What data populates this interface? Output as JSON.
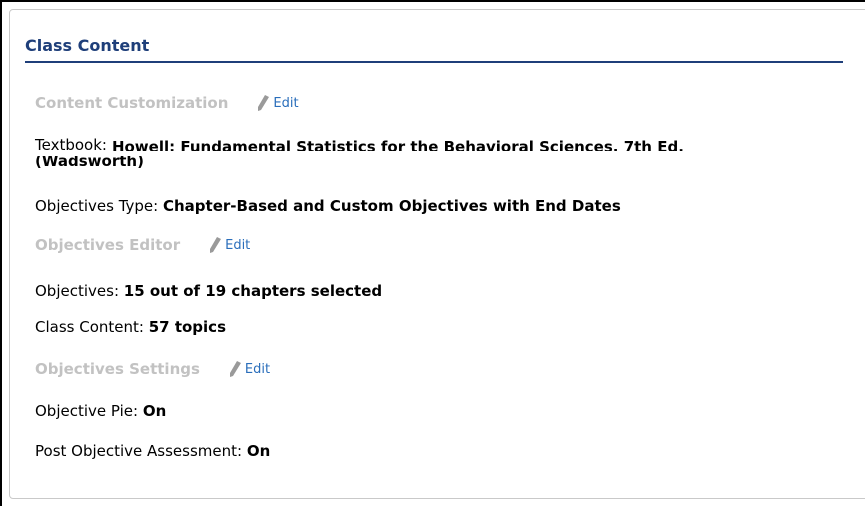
{
  "panel": {
    "title": "Class Content",
    "content_customization": {
      "label": "Content Customization",
      "edit": "Edit"
    },
    "textbook": {
      "label": "Textbook:",
      "value_line1": "Howell: Fundamental Statistics for the Behavioral Sciences, 7th Ed.",
      "value_line2": "(Wadsworth)"
    },
    "objectives_type": {
      "label": "Objectives Type:",
      "value": "Chapter-Based and Custom Objectives with End Dates"
    },
    "objectives_editor": {
      "label": "Objectives Editor",
      "edit": "Edit"
    },
    "objectives": {
      "label": "Objectives:",
      "value": "15 out of 19 chapters selected"
    },
    "class_content": {
      "label": "Class Content:",
      "value": "57 topics"
    },
    "objectives_settings": {
      "label": "Objectives Settings",
      "edit": "Edit"
    },
    "objective_pie": {
      "label": "Objective Pie:",
      "value": "On"
    },
    "post_objective_assessment": {
      "label": "Post Objective Assessment:",
      "value": "On"
    }
  }
}
